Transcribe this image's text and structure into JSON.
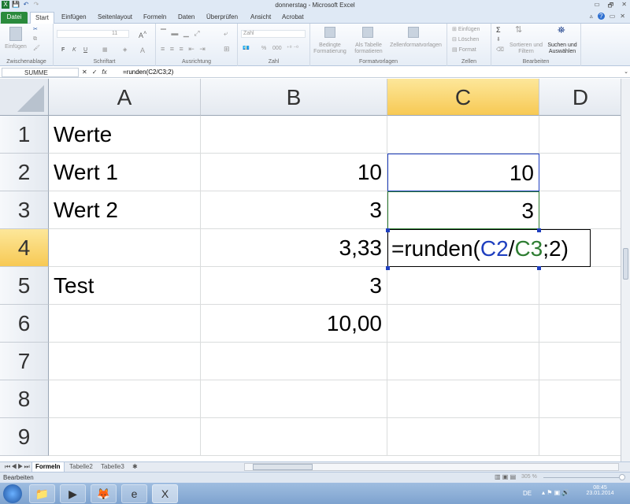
{
  "window": {
    "title": "donnerstag - Microsoft Excel",
    "minimize": "▭",
    "restore": "🗗",
    "close": "✕"
  },
  "qat": {
    "excel_icon": "X",
    "save": "💾",
    "undo": "↶",
    "redo": "↷"
  },
  "ribbon_tabs": [
    "Datei",
    "Start",
    "Einfügen",
    "Seitenlayout",
    "Formeln",
    "Daten",
    "Überprüfen",
    "Ansicht",
    "Acrobat"
  ],
  "ribbon": {
    "clipboard": {
      "paste": "Einfügen",
      "label": "Zwischenablage"
    },
    "font": {
      "size": "11",
      "bold": "F",
      "italic": "K",
      "underline": "U",
      "label": "Schriftart"
    },
    "alignment": {
      "label": "Ausrichtung"
    },
    "number": {
      "format": "Zahl",
      "percent": "%",
      "thousands": "000",
      "label": "Zahl"
    },
    "styles": {
      "conditional": "Bedingte Formatierung",
      "as_table": "Als Tabelle formatieren",
      "cell_styles": "Zellenformatvorlagen",
      "label": "Formatvorlagen"
    },
    "cells": {
      "insert": "Einfügen",
      "delete": "Löschen",
      "format": "Format",
      "label": "Zellen"
    },
    "editing": {
      "sum": "Σ",
      "sort": "Sortieren und Filtern",
      "find": "Suchen und Auswählen",
      "label": "Bearbeiten"
    }
  },
  "formula_bar": {
    "name_box": "SUMME",
    "cancel": "✕",
    "enter": "✓",
    "fx": "fx",
    "formula": "=runden(C2/C3;2)"
  },
  "columns": [
    "A",
    "B",
    "C",
    "D"
  ],
  "selected_column": "C",
  "rows": [
    "1",
    "2",
    "3",
    "4",
    "5",
    "6",
    "7",
    "8",
    "9"
  ],
  "selected_row": "4",
  "cells": {
    "A1": "Werte",
    "A2": "Wert 1",
    "A3": "Wert 2",
    "A5": "Test",
    "B2": "10",
    "B3": "3",
    "B4": "3,33",
    "B5": "3",
    "B6": "10,00",
    "C2": "10",
    "C3": "3"
  },
  "editing_cell": {
    "parts": [
      "=runden(",
      "C2",
      "/",
      "C3",
      ";2)"
    ],
    "ref_colors": {
      "C2": "#1f3fbf",
      "C3": "#2e7d32"
    }
  },
  "sheet_tabs": [
    "Formeln",
    "Tabelle2",
    "Tabelle3"
  ],
  "status": {
    "mode": "Bearbeiten",
    "zoom": "305 %"
  },
  "taskbar": {
    "lang": "DE",
    "time": "08:45",
    "date": "23.01.2014"
  }
}
